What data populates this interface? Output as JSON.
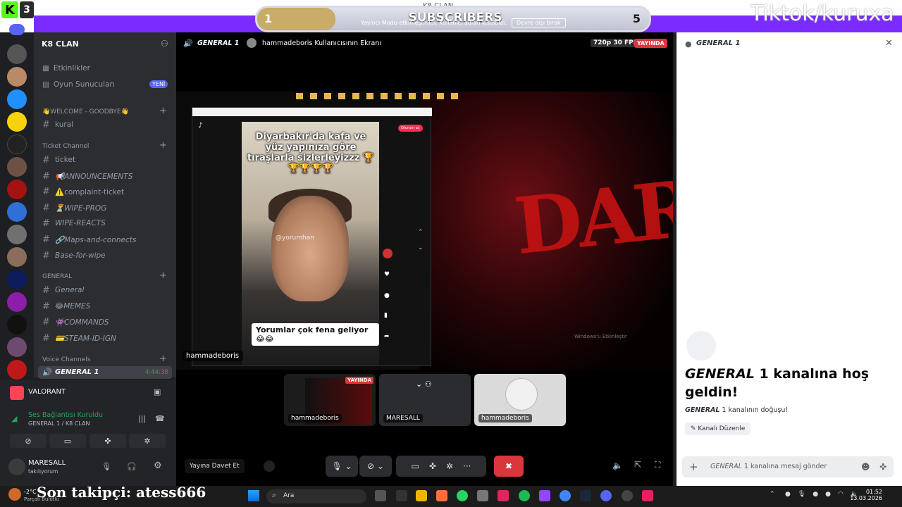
{
  "overlay": {
    "kick_badge": "K",
    "kick_count": "3",
    "window_title": "K8 CLAN",
    "subscribers_label": "SUBSCRIBERS",
    "subscribers_current": "1",
    "subscribers_goal": "5",
    "subscribers_progress": 0.2,
    "streamer_mode_msg": "Yayıncı Modu etkinleştirildi. Kullanıcı adları kısaltıldı.",
    "disable_button": "Devre dışı bırak",
    "tiktok_tag": "Tiktok/kuruxa"
  },
  "sidebar": {
    "server_name": "K8 CLAN",
    "top_items": [
      {
        "label": "Etkinlikler",
        "icon": "calendar-icon"
      },
      {
        "label": "Oyun Sunucuları",
        "icon": "server-icon",
        "badge": "YENİ"
      }
    ],
    "categories": [
      {
        "label": "👋WELCOME - GOODBYE👋",
        "channels": [
          "kural"
        ]
      },
      {
        "label": "Ticket Channel",
        "channels": [
          "ticket",
          "📢ANNOUNCEMENTS",
          "⚠️complaint-ticket",
          "⏳WIPE-PROG",
          "WIPE-REACTS",
          "🔗Maps-and-connects",
          "Base-for-wipe"
        ]
      },
      {
        "label": "GENERAL",
        "channels": [
          "General",
          "😂MEMES",
          "👾COMMANDS",
          "💳STEAM-ID-IGN"
        ]
      },
      {
        "label": "Voice Channels",
        "channels": [
          "GENERAL 1"
        ]
      }
    ],
    "active_voice": {
      "name": "GENERAL 1",
      "timer": "4:44:38"
    }
  },
  "voice_panel": {
    "game": "VALORANT",
    "status": "Ses Bağlantısı Kuruldu",
    "location": "GENERAL 1 / K8 CLAN",
    "user_name": "MARESALL",
    "user_status": "takılıyorum"
  },
  "stream": {
    "channel": "GENERAL 1",
    "title": "hammadeboris Kullanıcısının Ekranı",
    "quality": "720p 30 FPS",
    "live_label": "YAYINDA",
    "name_tag": "hammadeboris",
    "tiktok_caption_top": "Diyarbakır'da kafa ve yüz yapınıza göre tıraşlarla sizlerleyizzz 🏆🏆🏆🏆🏆",
    "tiktok_caption_bottom": "Yorumlar çok fena geliyor 😂😂",
    "tiktok_handle": "@yorumhan",
    "tiktok_follow": "Oturum aç",
    "wallpaper_text": "DARX",
    "activate_windows": "Windows'u Etkinleştir",
    "tiles": [
      {
        "label": "hammadeboris",
        "live": "YAYINDA"
      },
      {
        "label": "MARESALL"
      },
      {
        "label": "hammadeboris"
      }
    ],
    "invite_button": "Yayına Davet Et"
  },
  "chat": {
    "header": "GENERAL 1",
    "welcome_channel": "GENERAL",
    "welcome_number": "1",
    "welcome_rest": "kanalına hoş geldin!",
    "origin_channel": "GENERAL",
    "origin_rest": "1 kanalının doğuşu!",
    "edit_button": "Kanalı Düzenle",
    "input_channel": "GENERAL",
    "input_placeholder": "1 kanalına mesaj gönder"
  },
  "taskbar": {
    "ticker": "Son takipçi: atess666",
    "temp": "-2°C",
    "weather": "Parçalı Bulutlu",
    "search": "Ara",
    "time": "01:52",
    "date": "13.03.2026"
  }
}
